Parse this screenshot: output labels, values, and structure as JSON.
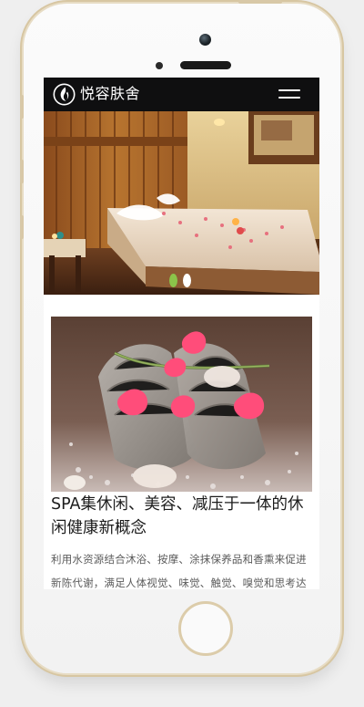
{
  "header": {
    "brand": "悦容肤舍",
    "logo_icon": "flame-leaf-logo-icon",
    "menu_icon": "hamburger-menu-icon"
  },
  "hero": {
    "slide_count": 2,
    "active_slide": 1,
    "colors": {
      "active_dot": "#8bc34a",
      "inactive_dot": "#ffffff"
    }
  },
  "article": {
    "title": "SPA集休闲、美容、减压于一体的休闲健康新概念",
    "description": "利用水资源结合沐浴、按摩、涂抹保养品和香熏来促进新陈代谢，满足人体视觉、味觉、触觉、嗅觉和思考达到一种身心畅"
  },
  "theme": {
    "topbar_bg": "#0f0f10",
    "accent": "#8bc34a"
  }
}
